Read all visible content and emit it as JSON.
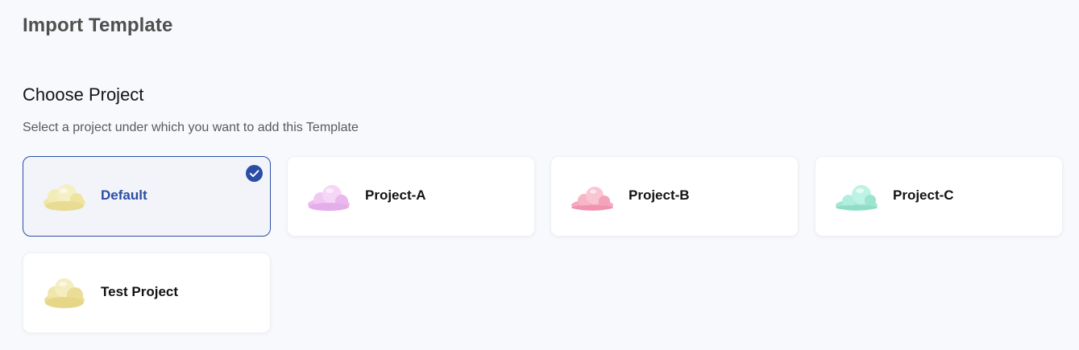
{
  "page": {
    "title": "Import Template"
  },
  "section": {
    "title": "Choose Project",
    "subtitle": "Select a project under which you want to add this Template"
  },
  "projects": [
    {
      "name": "Default",
      "selected": true,
      "icon": "cloud-icon",
      "color": "#efe6a8"
    },
    {
      "name": "Project-A",
      "selected": false,
      "icon": "cloud-icon",
      "color": "#f1c8f2"
    },
    {
      "name": "Project-B",
      "selected": false,
      "icon": "cloud-icon",
      "color": "#f7b6c8"
    },
    {
      "name": "Project-C",
      "selected": false,
      "icon": "cloud-icon",
      "color": "#a9ecd8"
    },
    {
      "name": "Test Project",
      "selected": false,
      "icon": "cloud-icon",
      "color": "#efe3a0"
    }
  ],
  "colors": {
    "accent": "#2b4da5",
    "background": "#f8f9fc"
  }
}
